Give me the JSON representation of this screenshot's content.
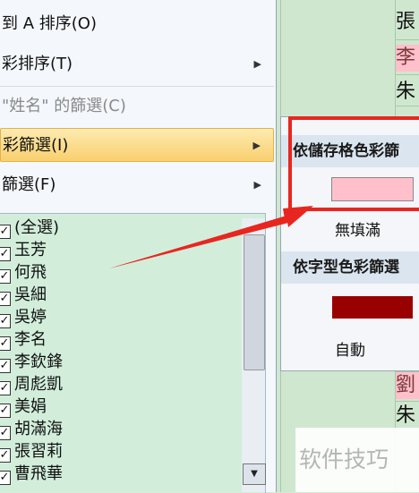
{
  "menu": {
    "items": [
      {
        "label": "到 A 排序(O)",
        "has_submenu": false,
        "disabled": false,
        "highlighted": false
      },
      {
        "label": "彩排序(T)",
        "has_submenu": true,
        "disabled": false,
        "highlighted": false
      },
      {
        "label": "\"姓名\" 的篩選(C)",
        "has_submenu": false,
        "disabled": true,
        "highlighted": false
      },
      {
        "label": "彩篩選(I)",
        "has_submenu": true,
        "disabled": false,
        "highlighted": true
      },
      {
        "label": "篩選(F)",
        "has_submenu": true,
        "disabled": false,
        "highlighted": false
      }
    ],
    "arrow_glyph": "▶"
  },
  "filter_list": {
    "items": [
      {
        "label": "(全選)",
        "checked": true
      },
      {
        "label": "玉芳",
        "checked": true
      },
      {
        "label": "何飛",
        "checked": true
      },
      {
        "label": "吳細",
        "checked": true
      },
      {
        "label": "吳婷",
        "checked": true
      },
      {
        "label": "李名",
        "checked": true
      },
      {
        "label": "李欽鋒",
        "checked": true
      },
      {
        "label": "周彪凱",
        "checked": true
      },
      {
        "label": "美娟",
        "checked": true
      },
      {
        "label": "胡滿海",
        "checked": true
      },
      {
        "label": "張習莉",
        "checked": true
      },
      {
        "label": "曹飛華",
        "checked": true
      }
    ],
    "check_glyph": "✓",
    "scroll_down_glyph": "▼"
  },
  "submenu": {
    "cell_color_header": "依儲存格色彩篩",
    "no_fill_label": "無填滿",
    "font_color_header": "依字型色彩篩選",
    "auto_label": "自動",
    "cell_color_swatch": "#ffc0cb",
    "font_color_swatch": "#990000"
  },
  "sheet": {
    "cells": [
      "張",
      "李",
      "朱",
      "劉",
      "朱"
    ]
  },
  "colors": {
    "highlight_box": "#e8261f",
    "arrow": "#e8261f",
    "pink_cell": "#ffc0cb"
  },
  "watermark": "软件技巧"
}
